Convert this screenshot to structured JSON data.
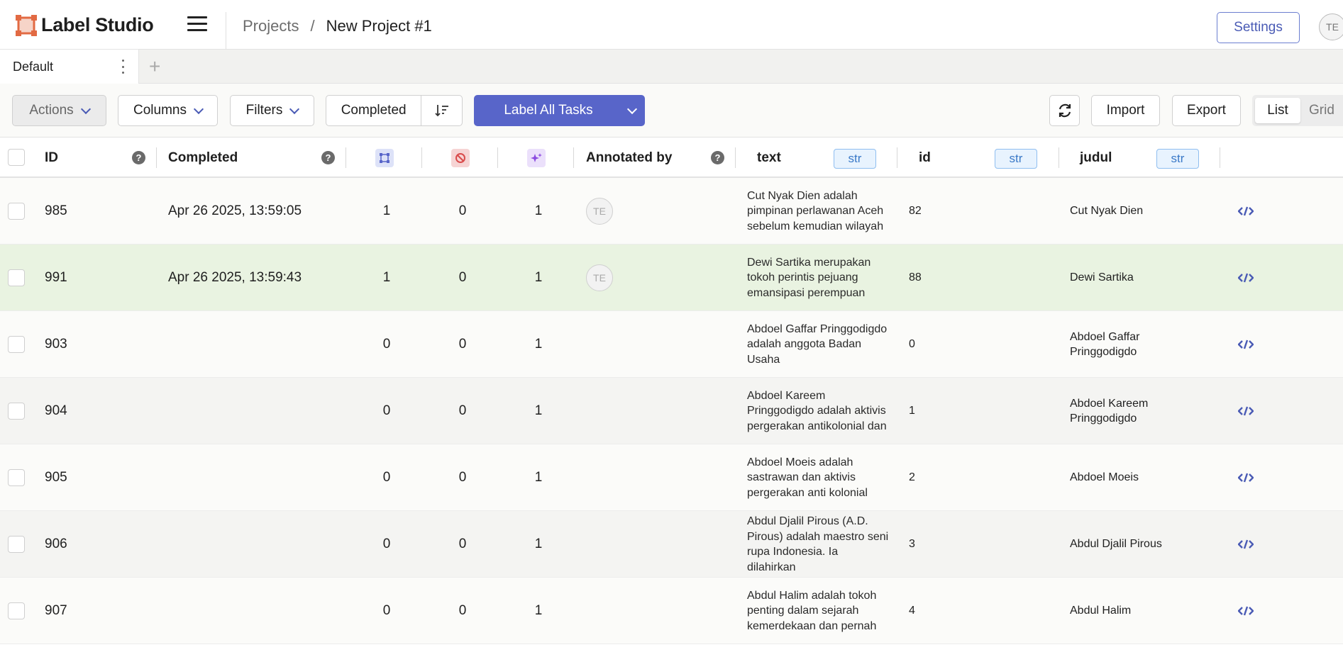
{
  "app": {
    "name": "Label Studio"
  },
  "breadcrumb": {
    "projects": "Projects",
    "separator": "/",
    "current": "New Project #1"
  },
  "header": {
    "settings_label": "Settings",
    "user_initials": "TE"
  },
  "tabs": [
    {
      "label": "Default"
    }
  ],
  "toolbar": {
    "actions_label": "Actions",
    "columns_label": "Columns",
    "filters_label": "Filters",
    "order_label": "Completed",
    "label_all_label": "Label All Tasks",
    "import_label": "Import",
    "export_label": "Export",
    "view_list_label": "List",
    "view_grid_label": "Grid"
  },
  "columns": {
    "id": "ID",
    "completed": "Completed",
    "annotated_by": "Annotated by",
    "text": "text",
    "text_type": "str",
    "idcol": "id",
    "id_type": "str",
    "judul": "judul",
    "judul_type": "str"
  },
  "colors": {
    "accent": "#5865c9",
    "highlight_row": "#e9f3e1"
  },
  "rows": [
    {
      "id": "985",
      "completed": "Apr 26 2025, 13:59:05",
      "annotations": "1",
      "cancelled": "0",
      "predictions": "1",
      "annotator": "TE",
      "text": "Cut Nyak Dien adalah pimpinan perlawanan Aceh sebelum kemudian wilayah",
      "idval": "82",
      "judul": "Cut Nyak Dien"
    },
    {
      "id": "991",
      "completed": "Apr 26 2025, 13:59:43",
      "annotations": "1",
      "cancelled": "0",
      "predictions": "1",
      "annotator": "TE",
      "text": "Dewi Sartika merupakan tokoh perintis pejuang emansipasi perempuan",
      "idval": "88",
      "judul": "Dewi Sartika"
    },
    {
      "id": "903",
      "completed": "",
      "annotations": "0",
      "cancelled": "0",
      "predictions": "1",
      "annotator": "",
      "text": "Abdoel Gaffar Pringgodigdo adalah anggota Badan Usaha",
      "idval": "0",
      "judul": "Abdoel Gaffar Pringgodigdo"
    },
    {
      "id": "904",
      "completed": "",
      "annotations": "0",
      "cancelled": "0",
      "predictions": "1",
      "annotator": "",
      "text": "Abdoel Kareem Pringgodigdo adalah aktivis pergerakan antikolonial dan",
      "idval": "1",
      "judul": "Abdoel Kareem Pringgodigdo"
    },
    {
      "id": "905",
      "completed": "",
      "annotations": "0",
      "cancelled": "0",
      "predictions": "1",
      "annotator": "",
      "text": "Abdoel Moeis adalah sastrawan dan aktivis pergerakan anti kolonial",
      "idval": "2",
      "judul": "Abdoel Moeis"
    },
    {
      "id": "906",
      "completed": "",
      "annotations": "0",
      "cancelled": "0",
      "predictions": "1",
      "annotator": "",
      "text": "Abdul Djalil Pirous (A.D. Pirous) adalah maestro seni rupa Indonesia. Ia dilahirkan",
      "idval": "3",
      "judul": "Abdul Djalil Pirous"
    },
    {
      "id": "907",
      "completed": "",
      "annotations": "0",
      "cancelled": "0",
      "predictions": "1",
      "annotator": "",
      "text": "Abdul Halim adalah tokoh penting dalam sejarah kemerdekaan dan pernah",
      "idval": "4",
      "judul": "Abdul Halim"
    }
  ]
}
